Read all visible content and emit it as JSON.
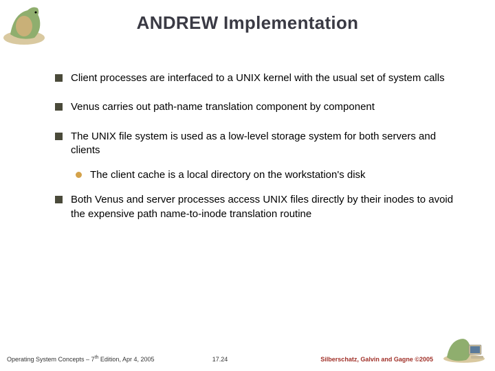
{
  "title": "ANDREW Implementation",
  "bullets": [
    "Client processes are interfaced to a UNIX kernel with the usual set of system calls",
    "Venus carries out path-name translation component by component",
    "The UNIX file system is used as a low-level storage system for both servers and clients",
    "Both Venus and server processes access UNIX files directly by their inodes to avoid the expensive path name-to-inode translation routine"
  ],
  "subbullet": "The client cache is a local directory on the workstation's disk",
  "footer": {
    "left_prefix": "Operating System Concepts – 7",
    "left_sup": "th",
    "left_suffix": " Edition, Apr 4, 2005",
    "center": "17.24",
    "right": "Silberschatz, Galvin and Gagne ©2005"
  },
  "icons": {
    "top": "dinosaur-illustration",
    "bottom": "dinosaur-computer-illustration"
  }
}
